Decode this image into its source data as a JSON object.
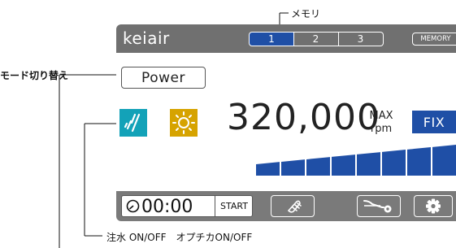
{
  "annotations": {
    "memory_label": "メモリ",
    "mode_switch_label": "モード切り替え",
    "water_light_label": "注水 ON/OFF　オプチカON/OFF"
  },
  "header": {
    "brand": "keiair",
    "memory_slots": [
      {
        "label": "1",
        "selected": true
      },
      {
        "label": "2",
        "selected": false
      },
      {
        "label": "3",
        "selected": false
      }
    ],
    "memory_button": "MEMORY"
  },
  "controls": {
    "power_label": "Power",
    "water_icon": "water-spray-icon",
    "light_icon": "light-bulb-icon",
    "speed_value": "320,000",
    "speed_max_label": "MAX",
    "speed_unit": "rpm",
    "fix_label": "FIX"
  },
  "speed_bar": {
    "segments_total": 8,
    "segments_filled": 8
  },
  "footer": {
    "timer_icon": "clock-icon",
    "timer_value": "00:00",
    "start_label": "START",
    "handpiece_icon": "handpiece-icon",
    "curve_icon": "curve-settings-icon",
    "settings_icon": "gear-icon"
  },
  "colors": {
    "header_bg": "#707070",
    "footer_bg": "#7a7a7a",
    "accent_blue": "#1f4fa6",
    "water_teal": "#13a2b8",
    "light_yellow": "#d6a300"
  }
}
